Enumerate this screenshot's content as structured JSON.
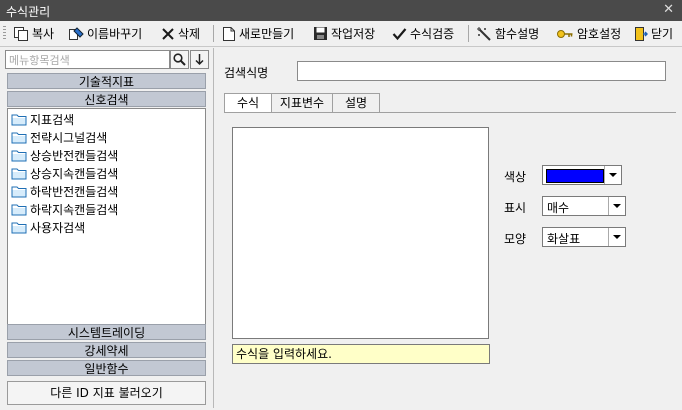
{
  "window": {
    "title": "수식관리",
    "close_glyph": "✕"
  },
  "toolbar": {
    "copy": "복사",
    "rename": "이름바꾸기",
    "delete": "삭제",
    "new": "새로만들기",
    "save": "작업저장",
    "verify": "수식검증",
    "func_help": "함수설명",
    "password": "암호설정",
    "close": "닫기"
  },
  "sidebar": {
    "search_placeholder": "메뉴항목검색",
    "categories_top": [
      "기술적지표",
      "신호검색"
    ],
    "items": [
      "지표검색",
      "전략시그널검색",
      "상승반전캔들검색",
      "상승지속캔들검색",
      "하락반전캔들검색",
      "하락지속캔들검색",
      "사용자검색"
    ],
    "categories_bottom": [
      "시스템트레이딩",
      "강세약세",
      "일반함수"
    ],
    "load_button": "다른 ID 지표 불러오기"
  },
  "main": {
    "name_label": "검색식명",
    "name_value": "",
    "tabs": [
      "수식",
      "지표변수",
      "설명"
    ],
    "formula_hint": "수식을 입력하세요.",
    "color_label": "색상",
    "color_value": "#0000ff",
    "display_label": "표시",
    "display_value": "매수",
    "shape_label": "모양",
    "shape_value": "화살표"
  }
}
